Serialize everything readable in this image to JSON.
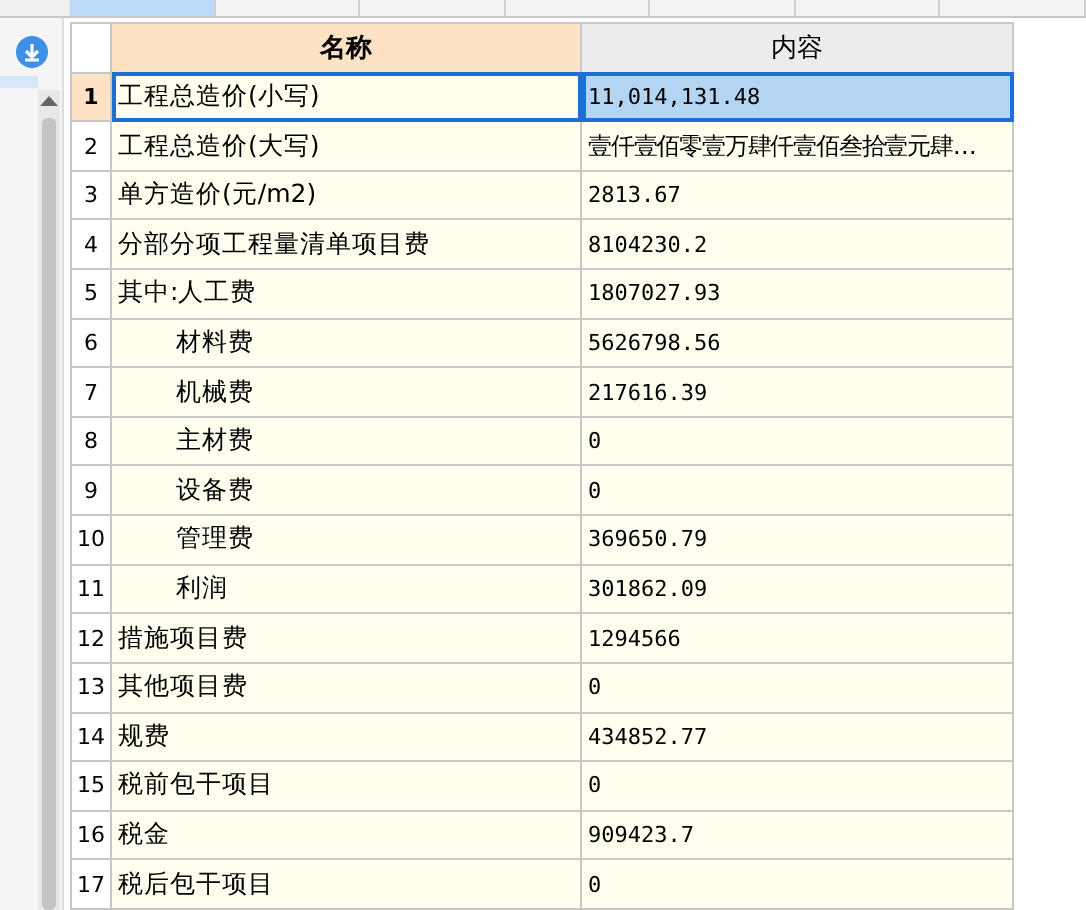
{
  "tabs": [
    {
      "selected": true
    },
    {
      "selected": false
    },
    {
      "selected": false
    },
    {
      "selected": false
    },
    {
      "selected": false
    },
    {
      "selected": false
    },
    {
      "selected": false
    }
  ],
  "sidebar": {
    "items": [
      {
        "selected": true
      }
    ]
  },
  "table": {
    "columns": [
      {
        "label": "名称",
        "selected": true
      },
      {
        "label": "内容",
        "selected": false
      }
    ],
    "rows": [
      {
        "number": "1",
        "name": "工程总造价(小写)",
        "value": "11,014,131.48",
        "selected": true
      },
      {
        "number": "2",
        "name": "工程总造价(大写)",
        "value": "壹仟壹佰零壹万肆仟壹佰叁拾壹元肆…",
        "selected": false
      },
      {
        "number": "3",
        "name": "单方造价(元/m2)",
        "value": "2813.67",
        "selected": false
      },
      {
        "number": "4",
        "name": "分部分项工程量清单项目费",
        "value": "8104230.2",
        "selected": false
      },
      {
        "number": "5",
        "name": "其中:人工费",
        "value": "1807027.93",
        "selected": false,
        "children": [
          {
            "number": "6",
            "name": "材料费",
            "value": "5626798.56",
            "selected": false
          },
          {
            "number": "7",
            "name": "机械费",
            "value": "217616.39",
            "selected": false
          },
          {
            "number": "8",
            "name": "主材费",
            "value": "0",
            "selected": false
          },
          {
            "number": "9",
            "name": "设备费",
            "value": "0",
            "selected": false
          },
          {
            "number": "10",
            "name": "管理费",
            "value": "369650.79",
            "selected": false
          },
          {
            "number": "11",
            "name": "利润",
            "value": "301862.09",
            "selected": false
          }
        ]
      },
      {
        "number": "12",
        "name": "措施项目费",
        "value": "1294566",
        "selected": false
      },
      {
        "number": "13",
        "name": "其他项目费",
        "value": "0",
        "selected": false
      },
      {
        "number": "14",
        "name": "规费",
        "value": "434852.77",
        "selected": false
      },
      {
        "number": "15",
        "name": "税前包干项目",
        "value": "0",
        "selected": false
      },
      {
        "number": "16",
        "name": "税金",
        "value": "909423.7",
        "selected": false
      },
      {
        "number": "17",
        "name": "税后包干项目",
        "value": "0",
        "selected": false
      }
    ]
  }
}
